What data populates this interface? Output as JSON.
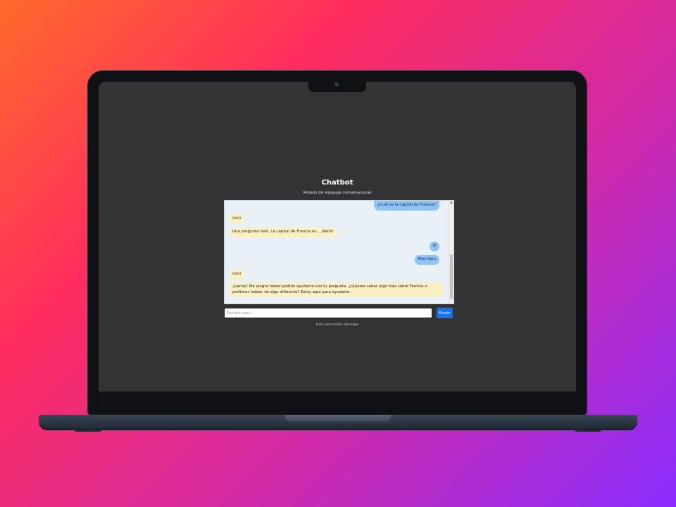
{
  "app": {
    "title": "Chatbot",
    "subtitle": "Modelo de lenguaje conversacional"
  },
  "messages": [
    {
      "role": "user",
      "text": "¿Cuál es la capital de Francia?"
    },
    {
      "role": "bot",
      "text": "(sin)"
    },
    {
      "role": "bot",
      "text": "Una pregunta fácil. La capital de Francia es... ¡París!"
    },
    {
      "role": "user",
      "text": "sí"
    },
    {
      "role": "user",
      "text": "Muy bien"
    },
    {
      "role": "bot",
      "text": "(sin)"
    },
    {
      "role": "bot",
      "text": "¡Genial! Me alegra haber podido ayudarte con tu pregunta. ¿Quieres saber algo más sobre Francia o prefieres hablar de algo diferente? Estoy aquí para ayudarte."
    }
  ],
  "input": {
    "placeholder": "Escribe aquí...",
    "value": ""
  },
  "send_button": {
    "label": "Enviar"
  },
  "status": {
    "text": "Listo para recibir mensajes"
  },
  "colors": {
    "screen_bg": "#333333",
    "chat_bg": "#e9f0f7",
    "user_bubble": "#8fc3f7",
    "bot_bubble": "#fbf0c4",
    "send_button": "#1a73e8"
  }
}
